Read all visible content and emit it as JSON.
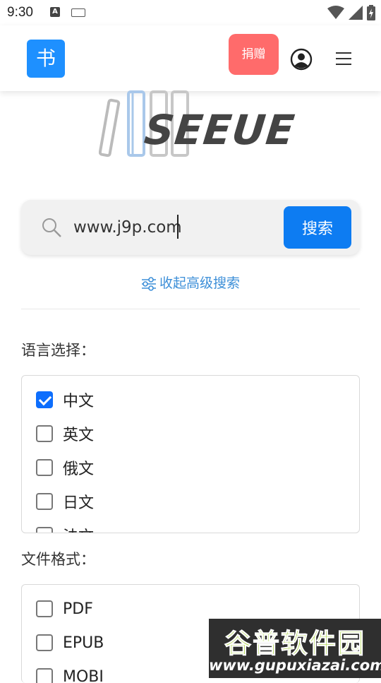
{
  "status": {
    "time": "9:30",
    "a_badge": "A"
  },
  "header": {
    "logo_char": "书",
    "donate_label": "捐赠"
  },
  "brand": {
    "text": "SEEUE"
  },
  "search": {
    "value": "www.j9p.com",
    "button_label": "搜索"
  },
  "advanced": {
    "toggle_label": "收起高级搜索"
  },
  "languages": {
    "label": "语言选择：",
    "options": [
      {
        "label": "中文",
        "checked": true
      },
      {
        "label": "英文",
        "checked": false
      },
      {
        "label": "俄文",
        "checked": false
      },
      {
        "label": "日文",
        "checked": false
      },
      {
        "label": "法文",
        "checked": false
      }
    ]
  },
  "formats": {
    "label": "文件格式：",
    "options": [
      {
        "label": "PDF",
        "checked": false
      },
      {
        "label": "EPUB",
        "checked": false
      },
      {
        "label": "MOBI",
        "checked": false
      }
    ]
  },
  "watermark": {
    "top": "谷普软件园",
    "bottom": "www.gupuxiazai.com"
  },
  "colors": {
    "primary": "#0d7cf2",
    "logo": "#1e90ff",
    "donate": "#ff6b6b",
    "link": "#3d8fd8"
  }
}
